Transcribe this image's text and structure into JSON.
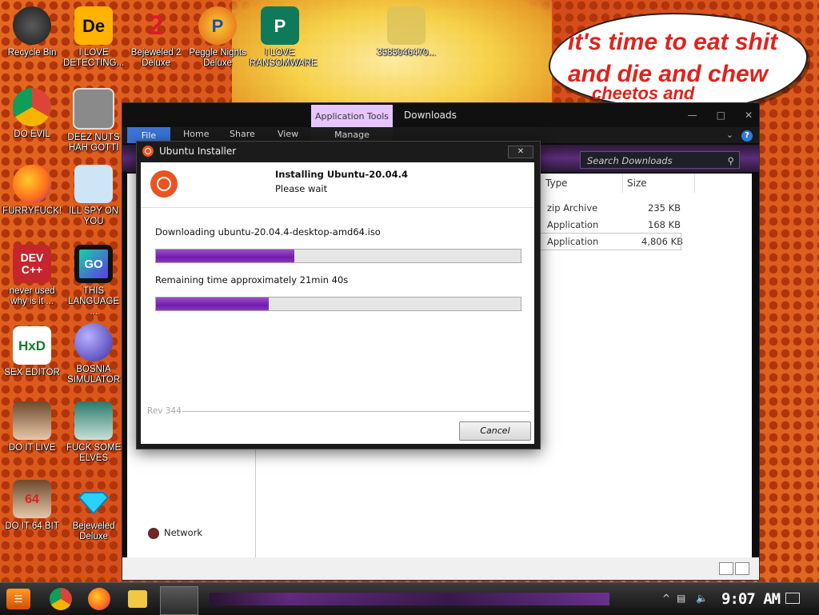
{
  "desktop": {
    "speech_bubble": {
      "line1": "it's time to eat shit",
      "line2": "and die and chew",
      "line3": "cheetos and"
    },
    "icons": [
      {
        "label": "Recycle Bin",
        "icon": "recycle-bin-icon"
      },
      {
        "label": "I LOVE DETECTING...",
        "icon": "detecting-app-icon"
      },
      {
        "label": "Bejeweled 2 Deluxe",
        "icon": "bejeweled-2-icon"
      },
      {
        "label": "Peggle Nights Deluxe",
        "icon": "peggle-icon"
      },
      {
        "label": "I LOVE RANSOMWARE",
        "icon": "publisher-icon"
      },
      {
        "label": "3585046470...",
        "icon": "image-file-icon"
      },
      {
        "label": "DO EVIL",
        "icon": "chrome-icon"
      },
      {
        "label": "DEEZ NUTS HAH GOTTI",
        "icon": "windows-stack-icon"
      },
      {
        "label": "FURRYFUCK!",
        "icon": "firefox-icon"
      },
      {
        "label": "ILL SPY ON YOU",
        "icon": "spy-tool-icon"
      },
      {
        "label": "never used why is it ...",
        "icon": "devcpp-icon"
      },
      {
        "label": "THIS LANGUAGE ...",
        "icon": "goland-icon"
      },
      {
        "label": "SEX EDITOR",
        "icon": "hxd-icon"
      },
      {
        "label": "BOSNIA SIMULATOR",
        "icon": "mine-icon"
      },
      {
        "label": "DO IT LIVE",
        "icon": "portrait-icon"
      },
      {
        "label": "FUCK SOME ELVES",
        "icon": "santa-icon"
      },
      {
        "label": "DO IT 64 BIT",
        "icon": "portrait-64-icon"
      },
      {
        "label": "Bejeweled Deluxe",
        "icon": "diamond-icon"
      }
    ],
    "icon_glyphs": {
      "de": "De",
      "two": "2",
      "p": "P",
      "pub": "P",
      "dev": "DEV C++",
      "go": "GO",
      "hxd": "HxD",
      "six_four": "64"
    }
  },
  "explorer": {
    "app_tools_tab": "Application Tools",
    "title": "Downloads",
    "tabs": {
      "file": "File",
      "home": "Home",
      "share": "Share",
      "view": "View"
    },
    "manage": "Manage",
    "search_placeholder": "Search Downloads",
    "columns": {
      "type": "Type",
      "size": "Size"
    },
    "rows": [
      {
        "prefix": "M",
        "type": "zip Archive",
        "size": "235 KB"
      },
      {
        "prefix": "M",
        "type": "Application",
        "size": "168 KB"
      },
      {
        "prefix": "M",
        "type": "Application",
        "size": "4,806 KB"
      }
    ],
    "nav_item_network": "Network",
    "help_glyph": "?",
    "win_controls": {
      "minimize": "—",
      "maximize": "□",
      "close": "✕"
    }
  },
  "installer": {
    "window_title": "Ubuntu Installer",
    "heading": "Installing Ubuntu-20.04.4",
    "subheading": "Please wait",
    "download_text": "Downloading ubuntu-20.04.4-desktop-amd64.iso",
    "progress1": 0.38,
    "remaining_text": "Remaining time approximately 21min 40s",
    "progress2": 0.31,
    "rev": "Rev 344",
    "cancel": "Cancel"
  },
  "taskbar": {
    "clock": "9:07 AM",
    "start_glyph": "☰"
  },
  "colors": {
    "accent_purple": "#7a2bb0",
    "ubuntu_orange": "#e95420",
    "bubble_text": "#e0231b"
  }
}
